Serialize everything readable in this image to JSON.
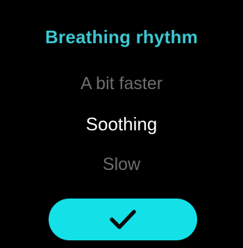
{
  "colors": {
    "background": "#000000",
    "accent": "#14E0E8",
    "title": "#3CC8D2",
    "option_dim": "#6E6E6E",
    "option_selected": "#FFFFFF",
    "check": "#0A0A0A"
  },
  "title": "Breathing rhythm",
  "picker": {
    "options": [
      "A bit faster",
      "Soothing",
      "Slow"
    ],
    "selected": "Soothing"
  },
  "confirm_button": {
    "icon": "checkmark-icon"
  }
}
